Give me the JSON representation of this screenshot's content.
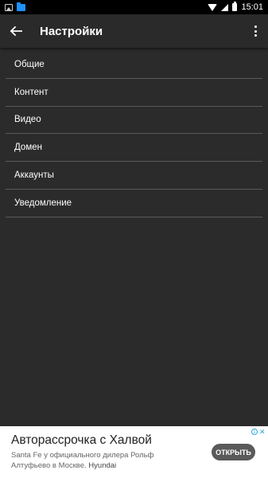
{
  "statusbar": {
    "time": "15:01",
    "icons": [
      "gallery-icon",
      "folder-icon",
      "wifi-icon",
      "signal-icon",
      "battery-icon"
    ]
  },
  "toolbar": {
    "title": "Настройки",
    "back_icon": "arrow-left-icon",
    "more_icon": "more-vert-icon"
  },
  "settings": {
    "items": [
      {
        "label": "Общие"
      },
      {
        "label": "Контент"
      },
      {
        "label": "Видео"
      },
      {
        "label": "Домен"
      },
      {
        "label": "Аккаунты"
      },
      {
        "label": "Уведомление"
      }
    ]
  },
  "ad": {
    "title": "Авторассрочка с Халвой",
    "text": "Santa Fe у официального дилера Рольф Алтуфьево в Москве.",
    "brand": "Hyundai",
    "cta": "ОТКРЫТЬ"
  },
  "colors": {
    "background": "#2b2b2b",
    "statusbar": "#000000",
    "divider": "#5a5a5a",
    "ad_button": "#5a5a5a",
    "ad_choices": "#29a8e0"
  }
}
